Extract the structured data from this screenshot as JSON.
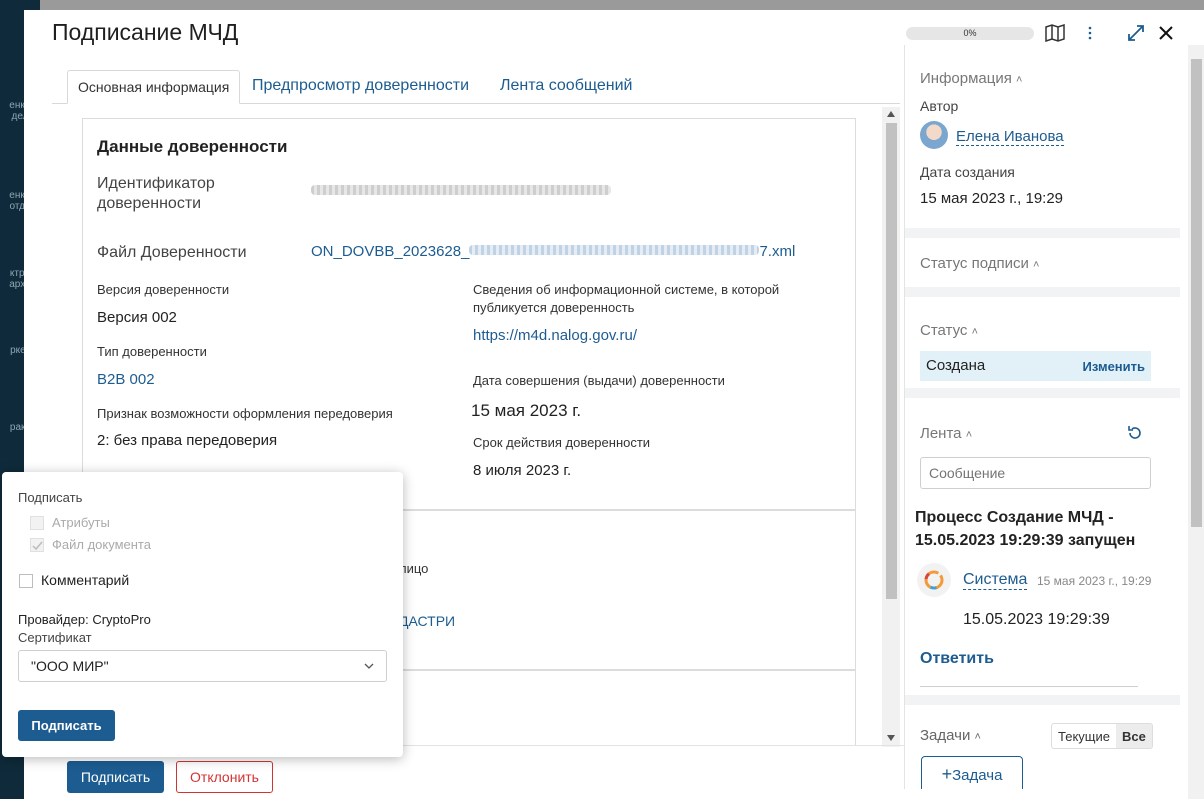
{
  "modal": {
    "title": "Подписание МЧД",
    "progress": "0%"
  },
  "tabs": [
    {
      "label": "Основная информация"
    },
    {
      "label": "Предпросмотр доверенности"
    },
    {
      "label": "Лента сообщений"
    }
  ],
  "card": {
    "title": "Данные доверенности",
    "id_label": "Идентификатор доверенности",
    "file_label": "Файл Доверенности",
    "file_value_prefix": "ON_DOVBB_2023628_",
    "file_value_suffix": "7.xml",
    "version_label": "Версия доверенности",
    "version_value": "Версия 002",
    "type_label": "Тип доверенности",
    "type_value": "B2B 002",
    "redelegation_label": "Признак возможности оформления передоверия",
    "redelegation_value": "2: без права передоверия",
    "infosys_label": "Сведения об информационной системе, в которой публикуется доверенность",
    "infosys_value": "https://m4d.nalog.gov.ru/",
    "issue_date_label": "Дата совершения (выдачи) доверенности",
    "issue_date_value": "15 мая 2023 г.",
    "expiry_label": "Срок действия доверенности",
    "expiry_value": "8 июля 2023 г."
  },
  "card2": {
    "partial_text": "лицо",
    "partial_link": "ДАСТРИ"
  },
  "footer": {
    "sign_label": "Подписать",
    "reject_label": "Отклонить"
  },
  "sign_popup": {
    "title": "Подписать",
    "attributes_label": "Атрибуты",
    "document_file_label": "Файл документа",
    "comment_label": "Комментарий",
    "provider_label": "Провайдер: CryptoPro",
    "certificate_label": "Сертификат",
    "certificate_value": "\"ООО МИР\"",
    "sign_button": "Подписать"
  },
  "right_panel": {
    "info_title": "Информация",
    "author_label": "Автор",
    "author_name": "Елена Иванова",
    "created_label": "Дата создания",
    "created_value": "15 мая 2023 г., 19:29",
    "sign_status_title": "Статус подписи",
    "status_title": "Статус",
    "status_value": "Создана",
    "status_change": "Изменить",
    "feed_title": "Лента",
    "message_placeholder": "Сообщение",
    "feed_event": "Процесс Создание МЧД - 15.05.2023 19:29:39 запущен",
    "feed_author": "Система",
    "feed_time": "15 мая 2023 г., 19:29",
    "feed_body": "15.05.2023 19:29:39",
    "reply_label": "Ответить",
    "tasks_title": "Задачи",
    "filter_current": "Текущие",
    "filter_all": "Все",
    "add_task": "Задача"
  },
  "background_nav": [
    "енкл дел",
    "енкл отде",
    "ктро архи",
    "ркет",
    "ракт"
  ],
  "colors": {
    "accent": "#1d5c91",
    "danger": "#d23434",
    "status_bg": "#e2f0f8"
  }
}
